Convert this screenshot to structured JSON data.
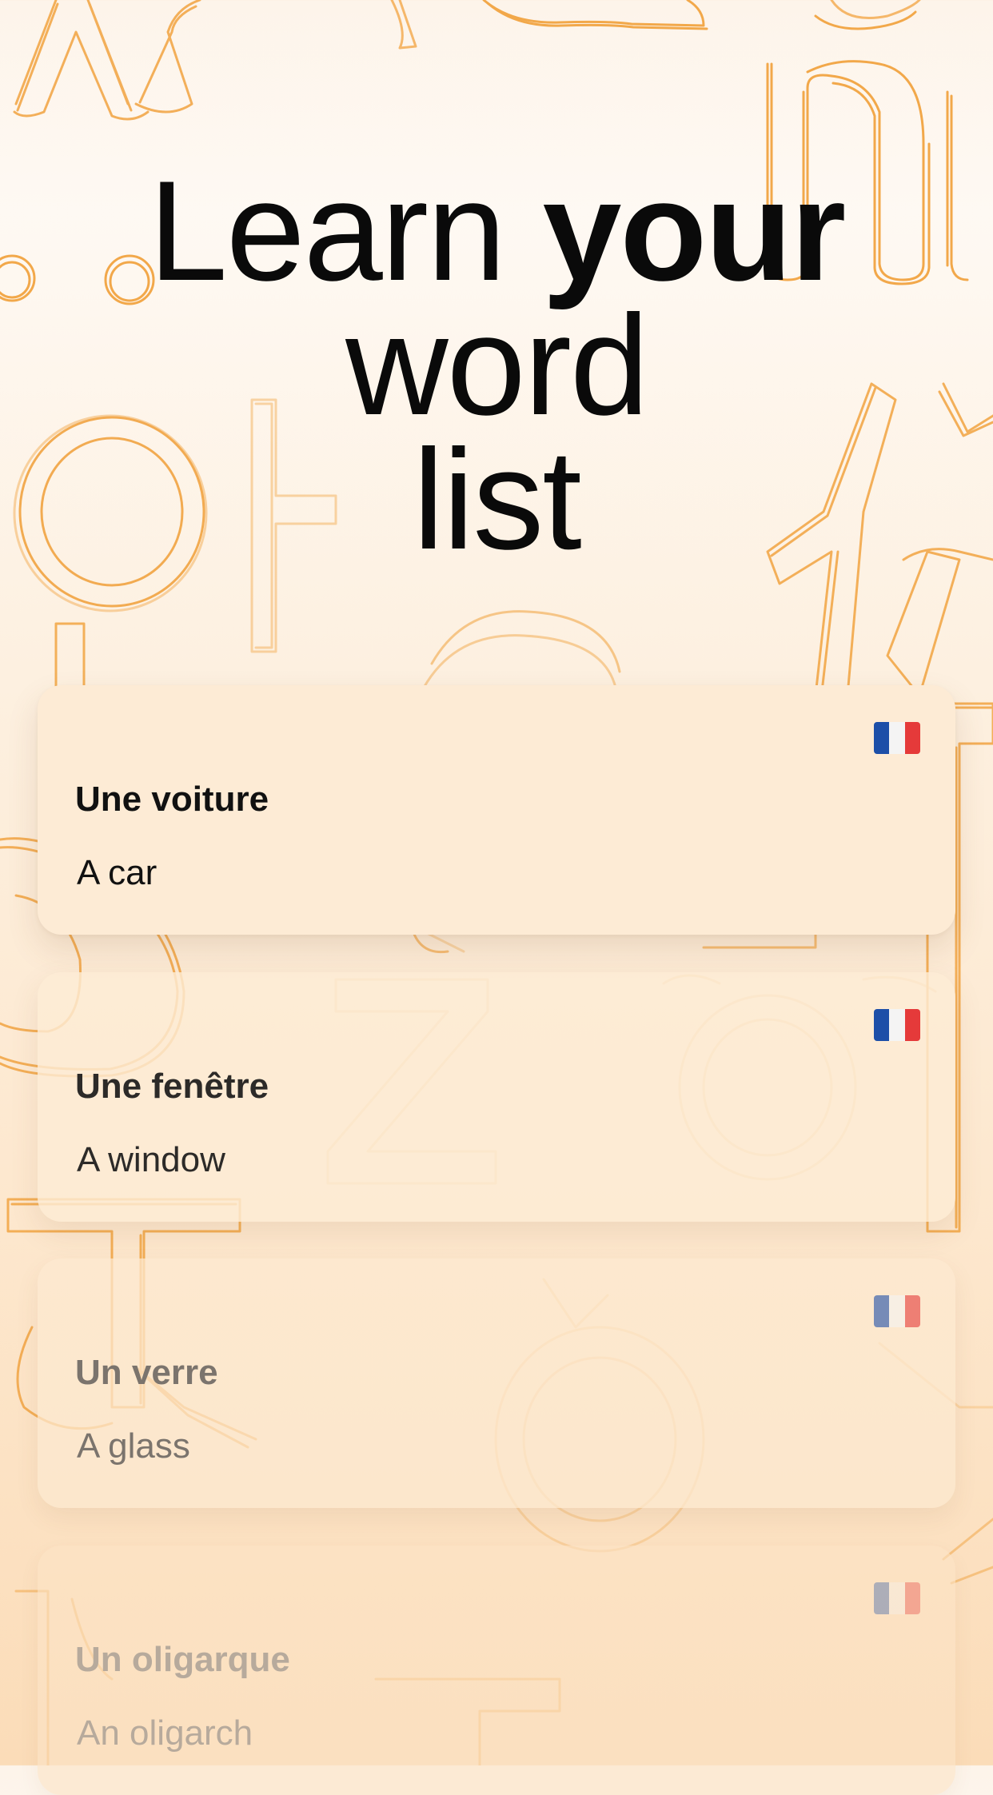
{
  "headline": {
    "part1": "Learn",
    "part2_bold": "your",
    "line2": "word",
    "line3": "list"
  },
  "colors": {
    "accent_outline": "#f0a23c",
    "card_background": "#fdebd5",
    "text": "#0a0a0a"
  },
  "cards": [
    {
      "word": "Une voiture",
      "translation": "A car",
      "flag_icon": "france-flag-icon"
    },
    {
      "word": "Une fenêtre",
      "translation": "A window",
      "flag_icon": "france-flag-icon"
    },
    {
      "word": "Un verre",
      "translation": "A glass",
      "flag_icon": "france-flag-icon"
    },
    {
      "word": "Un oligarque",
      "translation": "An oligarch",
      "flag_icon": "france-flag-icon"
    }
  ]
}
